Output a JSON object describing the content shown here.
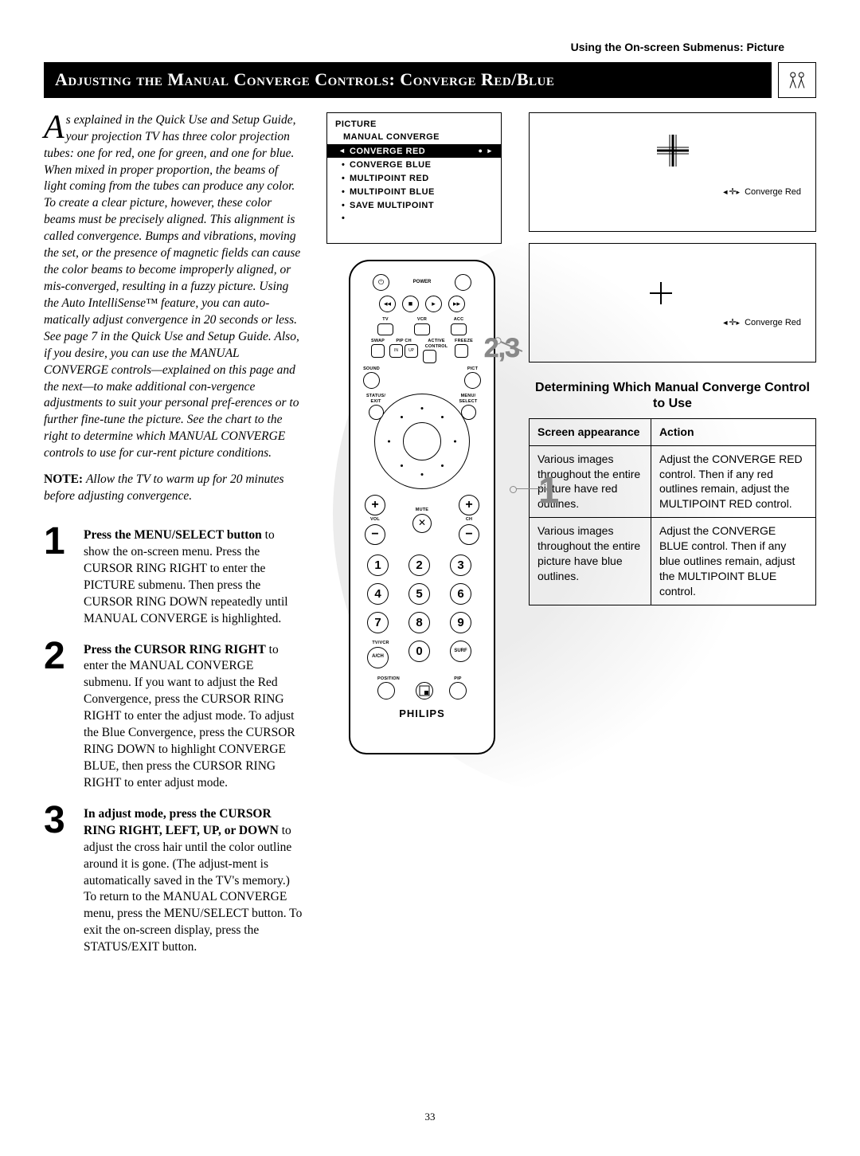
{
  "header_right": "Using the On-screen Submenus: Picture",
  "title_bar": "Adjusting the Manual Converge Controls: Converge Red/Blue",
  "intro": {
    "dropcap": "A",
    "text": "s explained in the Quick Use and Setup Guide, your projection TV has three color projection tubes: one for red, one for green, and one for blue. When mixed in proper proportion, the beams of light coming from the tubes can produce any color. To create a clear picture, however, these color beams must be precisely aligned. This alignment is called convergence. Bumps and vibrations, moving the set, or the presence of magnetic fields can cause the color beams to become improperly aligned, or mis-converged, resulting in a fuzzy picture. Using the Auto IntelliSense™ feature, you can auto-matically adjust convergence in 20 seconds or less. See page 7 in the Quick Use and Setup Guide. Also, if you desire, you can use the MANUAL CONVERGE controls—explained on this page and the next—to make additional con-vergence adjustments to suit your personal pref-erences or to further fine-tune the picture. See the chart to the right to determine which MANUAL CONVERGE controls to use for cur-rent picture conditions."
  },
  "note": {
    "label": "NOTE:",
    "body": "Allow the TV to warm up for 20 minutes before adjusting convergence."
  },
  "steps": [
    {
      "num": "1",
      "lead": "Press the MENU/SELECT button",
      "rest": " to show the on-screen menu. Press the CURSOR RING RIGHT to enter the PICTURE submenu. Then press the CURSOR RING DOWN repeatedly until MANUAL CONVERGE is highlighted."
    },
    {
      "num": "2",
      "lead": "Press the CURSOR RING RIGHT",
      "rest": " to enter the MANUAL CONVERGE submenu. If you want to adjust the Red Convergence, press the CURSOR RING RIGHT to enter the adjust mode. To adjust the Blue Convergence, press the CURSOR RING DOWN to highlight CONVERGE BLUE, then press the CURSOR RING RIGHT to enter adjust mode."
    },
    {
      "num": "3",
      "lead": "In adjust mode, press the CURSOR RING RIGHT, LEFT, UP, or DOWN",
      "rest": " to adjust the cross hair until the color outline around it is gone. (The adjust-ment is automatically saved in the TV's memory.) To return to the MANUAL CONVERGE menu, press the MENU/SELECT button. To exit the on-screen display, press the STATUS/EXIT button."
    }
  ],
  "menu": {
    "title": "PICTURE",
    "subtitle": "MANUAL CONVERGE",
    "items": [
      {
        "label": "CONVERGE RED",
        "selected": true
      },
      {
        "label": "CONVERGE BLUE",
        "selected": false
      },
      {
        "label": "MULTIPOINT RED",
        "selected": false
      },
      {
        "label": "MULTIPOINT BLUE",
        "selected": false
      },
      {
        "label": "SAVE MULTIPOINT",
        "selected": false
      }
    ]
  },
  "remote": {
    "labels": {
      "power": "POWER",
      "tv": "TV",
      "vcr": "VCR",
      "acc": "ACC",
      "swap": "SWAP",
      "pipch": "PIP CH",
      "active": "ACTIVE CONTROL",
      "freeze": "FREEZE",
      "sound": "SOUND",
      "pict": "PICT",
      "status": "STATUS/\nEXIT",
      "menu": "MENU/\nSELECT",
      "vol": "VOL",
      "mute": "MUTE",
      "ch": "CH",
      "tvvcr": "TV/VCR",
      "ach": "A/CH",
      "surf": "SURF",
      "position": "POSITION",
      "pip": "PIP",
      "in": "IN",
      "up": "UP"
    },
    "numbers": [
      "1",
      "2",
      "3",
      "4",
      "5",
      "6",
      "7",
      "8",
      "9",
      "A/CH",
      "0",
      "SURF"
    ],
    "brand": "PHILIPS"
  },
  "callouts": {
    "one": "1",
    "twothree": "2,3"
  },
  "converge_label": "Converge Red",
  "table": {
    "title": "Determining Which Manual Converge Control to Use",
    "head": [
      "Screen appearance",
      "Action"
    ],
    "rows": [
      {
        "screen": "Various images throughout the entire picture have red outlines.",
        "action": "Adjust the CONVERGE RED control. Then if any red outlines remain, adjust the MULTIPOINT RED control."
      },
      {
        "screen": "Various images throughout the entire picture have blue outlines.",
        "action": "Adjust the CONVERGE BLUE control. Then if any blue outlines remain, adjust the MULTIPOINT BLUE control."
      }
    ]
  },
  "page_number": "33"
}
